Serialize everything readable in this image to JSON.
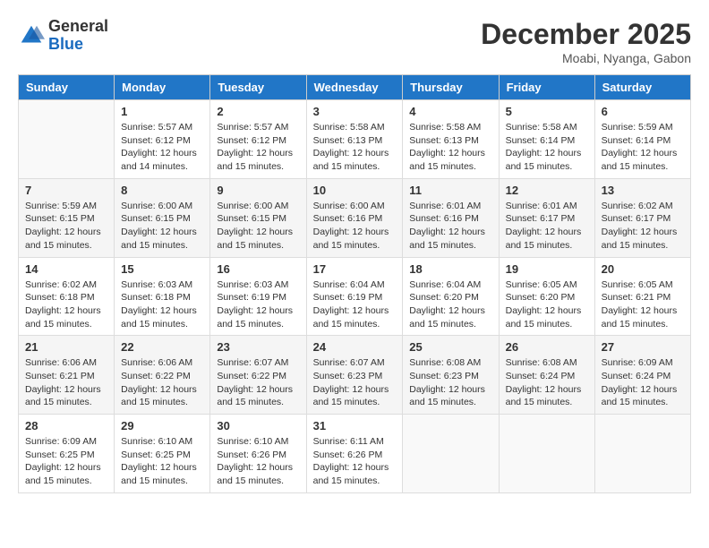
{
  "header": {
    "logo_line1": "General",
    "logo_line2": "Blue",
    "month_year": "December 2025",
    "location": "Moabi, Nyanga, Gabon"
  },
  "weekdays": [
    "Sunday",
    "Monday",
    "Tuesday",
    "Wednesday",
    "Thursday",
    "Friday",
    "Saturday"
  ],
  "weeks": [
    [
      {
        "day": "",
        "info": ""
      },
      {
        "day": "1",
        "info": "Sunrise: 5:57 AM\nSunset: 6:12 PM\nDaylight: 12 hours\nand 14 minutes."
      },
      {
        "day": "2",
        "info": "Sunrise: 5:57 AM\nSunset: 6:12 PM\nDaylight: 12 hours\nand 15 minutes."
      },
      {
        "day": "3",
        "info": "Sunrise: 5:58 AM\nSunset: 6:13 PM\nDaylight: 12 hours\nand 15 minutes."
      },
      {
        "day": "4",
        "info": "Sunrise: 5:58 AM\nSunset: 6:13 PM\nDaylight: 12 hours\nand 15 minutes."
      },
      {
        "day": "5",
        "info": "Sunrise: 5:58 AM\nSunset: 6:14 PM\nDaylight: 12 hours\nand 15 minutes."
      },
      {
        "day": "6",
        "info": "Sunrise: 5:59 AM\nSunset: 6:14 PM\nDaylight: 12 hours\nand 15 minutes."
      }
    ],
    [
      {
        "day": "7",
        "info": "Sunrise: 5:59 AM\nSunset: 6:15 PM\nDaylight: 12 hours\nand 15 minutes."
      },
      {
        "day": "8",
        "info": "Sunrise: 6:00 AM\nSunset: 6:15 PM\nDaylight: 12 hours\nand 15 minutes."
      },
      {
        "day": "9",
        "info": "Sunrise: 6:00 AM\nSunset: 6:15 PM\nDaylight: 12 hours\nand 15 minutes."
      },
      {
        "day": "10",
        "info": "Sunrise: 6:00 AM\nSunset: 6:16 PM\nDaylight: 12 hours\nand 15 minutes."
      },
      {
        "day": "11",
        "info": "Sunrise: 6:01 AM\nSunset: 6:16 PM\nDaylight: 12 hours\nand 15 minutes."
      },
      {
        "day": "12",
        "info": "Sunrise: 6:01 AM\nSunset: 6:17 PM\nDaylight: 12 hours\nand 15 minutes."
      },
      {
        "day": "13",
        "info": "Sunrise: 6:02 AM\nSunset: 6:17 PM\nDaylight: 12 hours\nand 15 minutes."
      }
    ],
    [
      {
        "day": "14",
        "info": "Sunrise: 6:02 AM\nSunset: 6:18 PM\nDaylight: 12 hours\nand 15 minutes."
      },
      {
        "day": "15",
        "info": "Sunrise: 6:03 AM\nSunset: 6:18 PM\nDaylight: 12 hours\nand 15 minutes."
      },
      {
        "day": "16",
        "info": "Sunrise: 6:03 AM\nSunset: 6:19 PM\nDaylight: 12 hours\nand 15 minutes."
      },
      {
        "day": "17",
        "info": "Sunrise: 6:04 AM\nSunset: 6:19 PM\nDaylight: 12 hours\nand 15 minutes."
      },
      {
        "day": "18",
        "info": "Sunrise: 6:04 AM\nSunset: 6:20 PM\nDaylight: 12 hours\nand 15 minutes."
      },
      {
        "day": "19",
        "info": "Sunrise: 6:05 AM\nSunset: 6:20 PM\nDaylight: 12 hours\nand 15 minutes."
      },
      {
        "day": "20",
        "info": "Sunrise: 6:05 AM\nSunset: 6:21 PM\nDaylight: 12 hours\nand 15 minutes."
      }
    ],
    [
      {
        "day": "21",
        "info": "Sunrise: 6:06 AM\nSunset: 6:21 PM\nDaylight: 12 hours\nand 15 minutes."
      },
      {
        "day": "22",
        "info": "Sunrise: 6:06 AM\nSunset: 6:22 PM\nDaylight: 12 hours\nand 15 minutes."
      },
      {
        "day": "23",
        "info": "Sunrise: 6:07 AM\nSunset: 6:22 PM\nDaylight: 12 hours\nand 15 minutes."
      },
      {
        "day": "24",
        "info": "Sunrise: 6:07 AM\nSunset: 6:23 PM\nDaylight: 12 hours\nand 15 minutes."
      },
      {
        "day": "25",
        "info": "Sunrise: 6:08 AM\nSunset: 6:23 PM\nDaylight: 12 hours\nand 15 minutes."
      },
      {
        "day": "26",
        "info": "Sunrise: 6:08 AM\nSunset: 6:24 PM\nDaylight: 12 hours\nand 15 minutes."
      },
      {
        "day": "27",
        "info": "Sunrise: 6:09 AM\nSunset: 6:24 PM\nDaylight: 12 hours\nand 15 minutes."
      }
    ],
    [
      {
        "day": "28",
        "info": "Sunrise: 6:09 AM\nSunset: 6:25 PM\nDaylight: 12 hours\nand 15 minutes."
      },
      {
        "day": "29",
        "info": "Sunrise: 6:10 AM\nSunset: 6:25 PM\nDaylight: 12 hours\nand 15 minutes."
      },
      {
        "day": "30",
        "info": "Sunrise: 6:10 AM\nSunset: 6:26 PM\nDaylight: 12 hours\nand 15 minutes."
      },
      {
        "day": "31",
        "info": "Sunrise: 6:11 AM\nSunset: 6:26 PM\nDaylight: 12 hours\nand 15 minutes."
      },
      {
        "day": "",
        "info": ""
      },
      {
        "day": "",
        "info": ""
      },
      {
        "day": "",
        "info": ""
      }
    ]
  ]
}
